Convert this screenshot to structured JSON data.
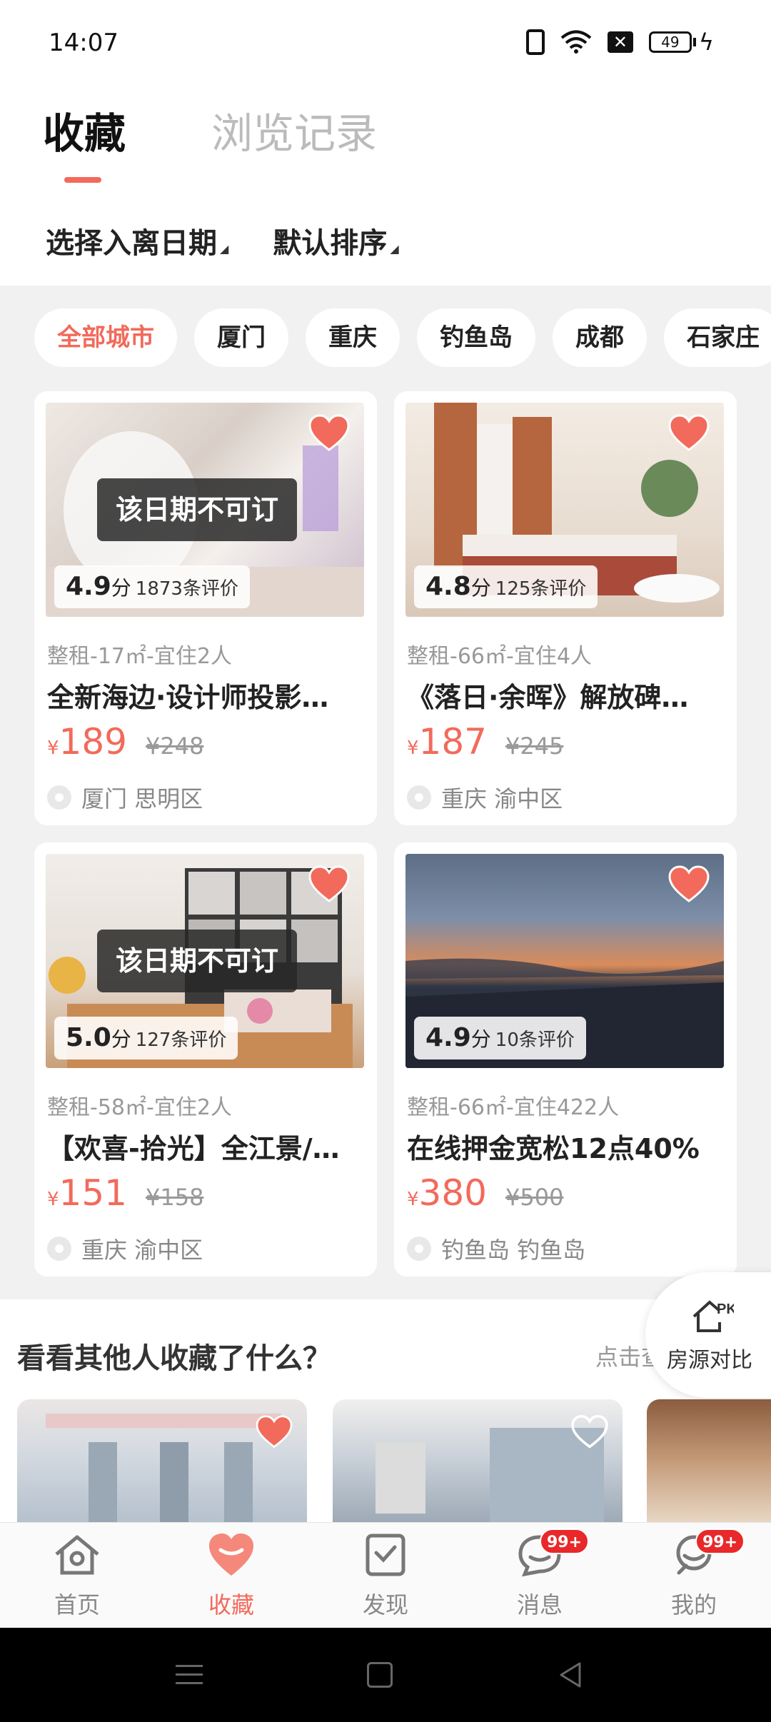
{
  "status_bar": {
    "time": "14:07",
    "battery": "49"
  },
  "tabs": [
    {
      "label": "收藏",
      "active": true
    },
    {
      "label": "浏览记录",
      "active": false
    }
  ],
  "filters": [
    {
      "label": "选择入离日期"
    },
    {
      "label": "默认排序"
    }
  ],
  "cities": [
    "全部城市",
    "厦门",
    "重庆",
    "钓鱼岛",
    "成都",
    "石家庄"
  ],
  "listings": [
    {
      "unavailable": "该日期不可订",
      "score": "4.9",
      "score_unit": "分",
      "reviews": "1873条评价",
      "spec": "整租-17㎡-宜住2人",
      "name": "全新海边·设计师投影…",
      "currency": "¥",
      "price": "189",
      "old_price": "¥248",
      "location": "厦门 思明区"
    },
    {
      "unavailable": "",
      "score": "4.8",
      "score_unit": "分",
      "reviews": "125条评价",
      "spec": "整租-66㎡-宜住4人",
      "name": "《落日·余晖》解放碑…",
      "currency": "¥",
      "price": "187",
      "old_price": "¥245",
      "location": "重庆 渝中区"
    },
    {
      "unavailable": "该日期不可订",
      "score": "5.0",
      "score_unit": "分",
      "reviews": "127条评价",
      "spec": "整租-58㎡-宜住2人",
      "name": "【欢喜-拾光】全江景/…",
      "currency": "¥",
      "price": "151",
      "old_price": "¥158",
      "location": "重庆 渝中区"
    },
    {
      "unavailable": "",
      "score": "4.9",
      "score_unit": "分",
      "reviews": "10条评价",
      "spec": "整租-66㎡-宜住422人",
      "name": "在线押金宽松12点40%",
      "currency": "¥",
      "price": "380",
      "old_price": "¥500",
      "location": "钓鱼岛 钓鱼岛"
    }
  ],
  "others": {
    "title": "看看其他人收藏了什么？",
    "hint": "点击查",
    "pk_badge": "PK",
    "pk_label": "房源对比"
  },
  "bottom_nav": [
    {
      "label": "首页",
      "icon": "home-icon"
    },
    {
      "label": "收藏",
      "icon": "heart-icon",
      "active": true
    },
    {
      "label": "发现",
      "icon": "discover-icon"
    },
    {
      "label": "消息",
      "icon": "message-icon",
      "badge": "99+"
    },
    {
      "label": "我的",
      "icon": "profile-icon",
      "badge": "99+"
    }
  ],
  "colors": {
    "accent": "#f26a5b",
    "badge": "#e8282a",
    "background": "#f1f1f1"
  }
}
